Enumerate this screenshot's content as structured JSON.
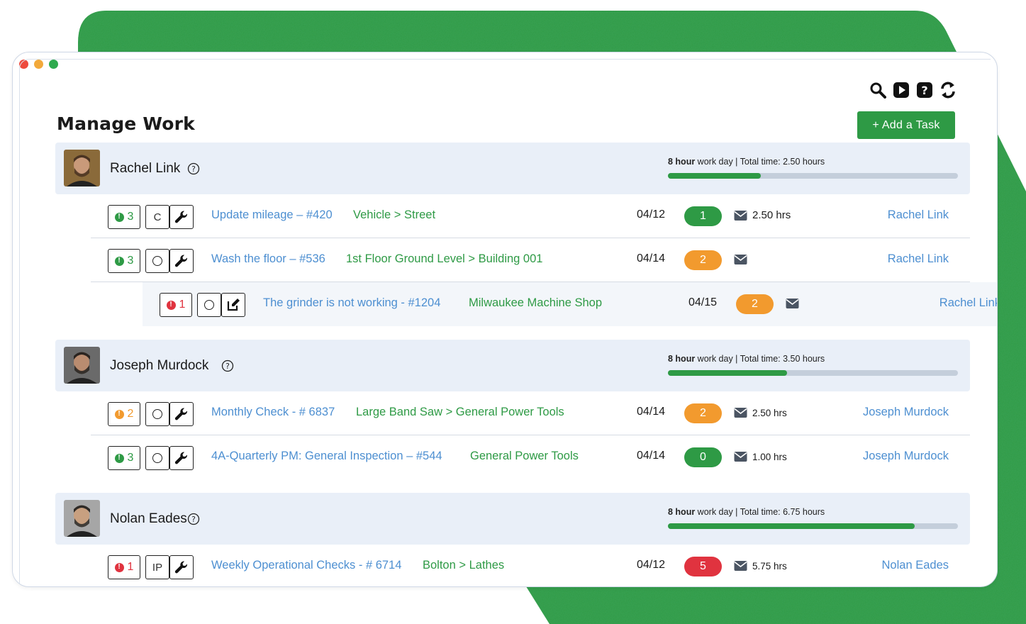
{
  "colors": {
    "brand_green": "#2e9a45",
    "link_blue": "#4d8fd1",
    "orange": "#f29a2e",
    "red": "#e0333f",
    "row_bg": "#e9eff8"
  },
  "toolbar": {
    "icons": [
      "search-icon",
      "play-icon",
      "help-icon",
      "sync-icon"
    ]
  },
  "page": {
    "title": "Manage Work",
    "add_task_label": "+ Add a Task"
  },
  "people": [
    {
      "name": "Rachel Link",
      "work_day_bold": "8 hour",
      "work_day_rest": " work day | Total time: 2.50 hours",
      "progress": 0.32,
      "tasks": [
        {
          "priority": "3",
          "priority_color": "green",
          "status": "C",
          "type_icon": "wrench-icon",
          "title": "Update mileage – #420",
          "location": "Vehicle > Street",
          "date": "04/12",
          "count": "1",
          "count_color": "green",
          "hours": "2.50 hrs",
          "assignee": "Rachel Link"
        },
        {
          "priority": "3",
          "priority_color": "green",
          "status": "",
          "type_icon": "wrench-icon",
          "title": "Wash the floor – #536",
          "location": "1st Floor Ground Level > Building 001",
          "date": "04/14",
          "count": "2",
          "count_color": "orange",
          "hours": "",
          "assignee": "Rachel Link"
        },
        {
          "priority": "1",
          "priority_color": "red",
          "status": "",
          "type_icon": "edit-icon",
          "title": "The grinder is not working - #1204",
          "location": "Milwaukee Machine Shop",
          "date": "04/15",
          "count": "2",
          "count_color": "orange",
          "hours": "",
          "assignee": "Rachel Link"
        }
      ]
    },
    {
      "name": "Joseph Murdock",
      "work_day_bold": "8 hour",
      "work_day_rest": " work day | Total time: 3.50 hours",
      "progress": 0.41,
      "tasks": [
        {
          "priority": "2",
          "priority_color": "orange",
          "status": "",
          "type_icon": "wrench-icon",
          "title": "Monthly Check - # 6837",
          "location": "Large Band Saw > General Power Tools",
          "date": "04/14",
          "count": "2",
          "count_color": "orange",
          "hours": "2.50 hrs",
          "assignee": "Joseph Murdock"
        },
        {
          "priority": "3",
          "priority_color": "green",
          "status": "",
          "type_icon": "wrench-icon",
          "title": "4A-Quarterly PM: General Inspection – #544",
          "location": "General Power Tools",
          "date": "04/14",
          "count": "0",
          "count_color": "green",
          "hours": "1.00 hrs",
          "assignee": "Joseph Murdock"
        }
      ]
    },
    {
      "name": "Nolan Eades",
      "work_day_bold": "8 hour",
      "work_day_rest": " work day | Total time: 6.75 hours",
      "progress": 0.85,
      "tasks": [
        {
          "priority": "1",
          "priority_color": "red",
          "status": "IP",
          "type_icon": "wrench-icon",
          "title": "Weekly Operational Checks - # 6714",
          "location": "Bolton > Lathes",
          "date": "04/12",
          "count": "5",
          "count_color": "red",
          "hours": "5.75 hrs",
          "assignee": "Nolan Eades"
        }
      ]
    }
  ]
}
